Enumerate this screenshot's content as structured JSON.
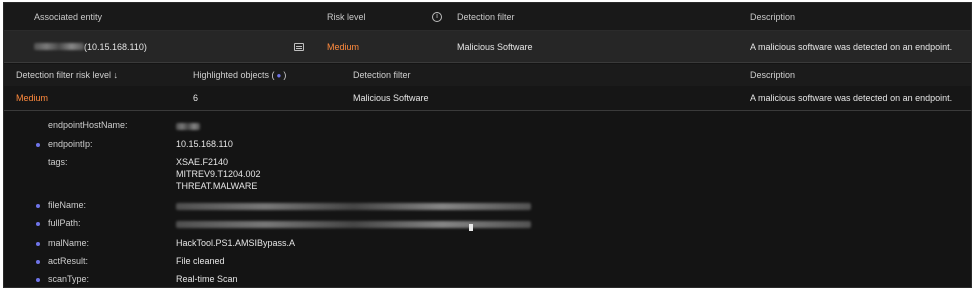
{
  "outer_table": {
    "headers": {
      "entity": "Associated entity",
      "risk": "Risk level",
      "filter": "Detection filter",
      "description": "Description"
    },
    "row": {
      "entity_ip": "(10.15.168.110)",
      "risk": "Medium",
      "filter": "Malicious Software",
      "description": "A malicious software was detected on an endpoint."
    }
  },
  "inner_table": {
    "headers": {
      "risk": "Detection filter risk level ↓",
      "highlighted": "Highlighted objects (",
      "highlighted_close": ")",
      "filter": "Detection filter",
      "description": "Description"
    },
    "row": {
      "risk": "Medium",
      "highlighted": "6",
      "filter": "Malicious Software",
      "description": "A malicious software was detected on an endpoint."
    }
  },
  "details": [
    {
      "key": "endpointHostName:",
      "highlighted": false
    },
    {
      "key": "endpointIp:",
      "value": "10.15.168.110",
      "highlighted": true
    },
    {
      "key": "tags:",
      "values": [
        "XSAE.F2140",
        "MITREV9.T1204.002",
        "THREAT.MALWARE"
      ],
      "highlighted": false
    },
    {
      "key": "fileName:",
      "highlighted": true
    },
    {
      "key": "fullPath:",
      "highlighted": true
    },
    {
      "key": "malName:",
      "value": "HackTool.PS1.AMSIBypass.A",
      "highlighted": true
    },
    {
      "key": "actResult:",
      "value": "File cleaned",
      "highlighted": true
    },
    {
      "key": "scanType:",
      "value": "Real-time Scan",
      "highlighted": true
    }
  ],
  "icons": {
    "info": "info-icon",
    "entity": "entity-card-icon",
    "highlight_dot": "highlight-dot-icon"
  },
  "colors": {
    "risk_medium": "#ff8a3d",
    "highlight": "#6f74e8",
    "background": "#141414"
  }
}
